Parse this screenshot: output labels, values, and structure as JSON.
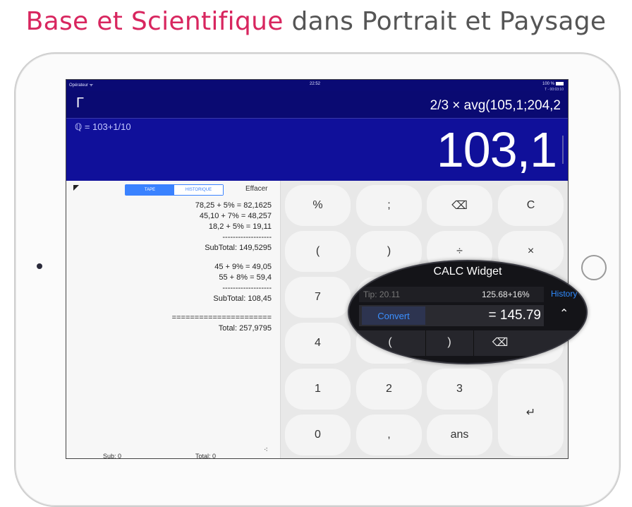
{
  "headline": {
    "part1": "Base et Scientifique",
    "part2": "dans Portrait et Paysage"
  },
  "status_bar": {
    "carrier": "Opérateur ᯤ",
    "time": "22:52",
    "battery": "100 %",
    "secondary_time": "T - 00:03:10"
  },
  "display": {
    "mode_symbol": "Γ",
    "expression": "2/3 × avg(105,1;204,2",
    "sub_expression": "ℚ = 103+1/10",
    "result": "103,1"
  },
  "tape": {
    "tabs": [
      "TAPE",
      "HISTORIQUE"
    ],
    "clear_label": "Effacer",
    "lines": [
      "78,25 + 5% = 82,1625",
      "45,10 + 7% = 48,257",
      "18,2 + 5% = 19,11",
      "-------------------",
      "SubTotal: 149,5295",
      "",
      "45 + 9% = 49,05",
      "55 + 8% = 59,4",
      "-------------------",
      "SubTotal: 108,45",
      "",
      "======================",
      "Total: 257,9795"
    ],
    "footer": {
      "sub": "Sub: 0",
      "total": "Total: 0",
      "grip": "⁖"
    }
  },
  "keypad": {
    "keys": [
      "%",
      ";",
      "⌫",
      "C",
      "(",
      ")",
      "÷",
      "×",
      "7",
      "4",
      "1",
      "2",
      "3",
      "↵",
      "0",
      ",",
      "ans"
    ]
  },
  "widget": {
    "title": "CALC Widget",
    "tip": "Tip: 20.11",
    "calc": "125.68+16%",
    "history": "History",
    "convert": "Convert",
    "result": "= 145.79",
    "chevron": "⌃",
    "keys": [
      "(",
      ")",
      "⌫"
    ]
  }
}
